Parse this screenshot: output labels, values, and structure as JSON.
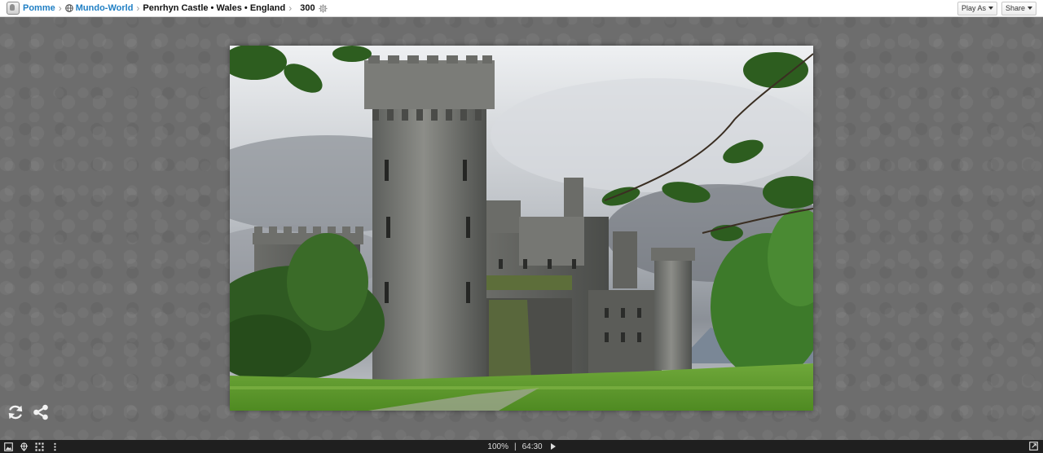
{
  "breadcrumb": {
    "user": "Pomme",
    "gallery": "Mundo-World",
    "title": "Penrhyn Castle • Wales • England",
    "pieces": "300"
  },
  "toolbar": {
    "play_as_label": "Play As",
    "share_label": "Share"
  },
  "status": {
    "zoom": "100%",
    "divider": "|",
    "timer": "64:30"
  },
  "icons": {
    "user": "avatar-icon",
    "globe": "globe-icon",
    "gear": "gear-icon",
    "restart": "refresh-icon",
    "share": "share-icon",
    "image": "image-preview-icon",
    "ghost": "ghost-image-icon",
    "edges": "edge-pieces-icon",
    "menu": "more-vertical-icon",
    "play": "play-icon",
    "fullscreen": "fullscreen-icon"
  },
  "colors": {
    "link": "#1f7fc4",
    "background": "#6d6d6d",
    "bottom_bar": "#1f1f1f"
  }
}
